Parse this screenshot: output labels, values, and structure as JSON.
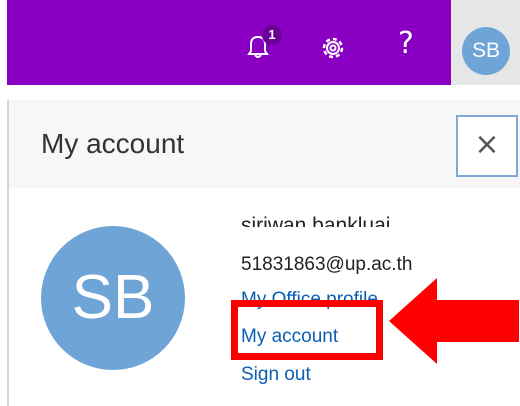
{
  "topbar": {
    "notifications": {
      "icon": "bell-icon",
      "badge_count": "1"
    },
    "settings": {
      "icon": "gear-icon"
    },
    "help": {
      "label": "?"
    },
    "avatar_initials": "SB",
    "color": "#8a00c2"
  },
  "panel": {
    "title": "My account",
    "close_label": "×"
  },
  "user": {
    "initials": "SB",
    "name": "siriwan bankluai",
    "email": "51831863@up.ac.th"
  },
  "links": {
    "profile": "My Office profile",
    "account": "My account",
    "signout": "Sign out"
  },
  "annotation": {
    "highlight_color": "#ff0000",
    "arrow_icon": "red-arrow-left-icon"
  }
}
